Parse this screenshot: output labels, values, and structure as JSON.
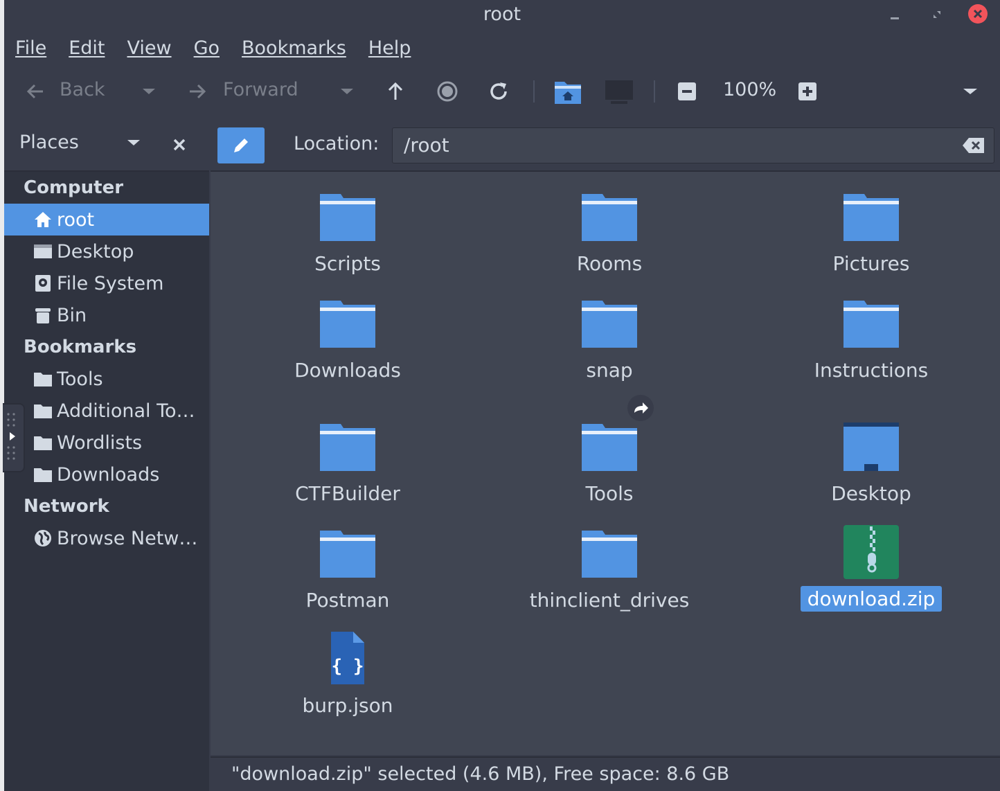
{
  "window": {
    "title": "root"
  },
  "menu": [
    {
      "label": "File"
    },
    {
      "label": "Edit"
    },
    {
      "label": "View"
    },
    {
      "label": "Go"
    },
    {
      "label": "Bookmarks"
    },
    {
      "label": "Help"
    }
  ],
  "toolbar": {
    "back_label": "Back",
    "forward_label": "Forward",
    "zoom_level": "100%"
  },
  "sidebar": {
    "places_label": "Places",
    "sections": {
      "computer": "Computer",
      "bookmarks": "Bookmarks",
      "network": "Network"
    },
    "computer_items": [
      {
        "label": "root",
        "icon": "home-icon"
      },
      {
        "label": "Desktop",
        "icon": "desktop-icon"
      },
      {
        "label": "File System",
        "icon": "drive-icon"
      },
      {
        "label": "Bin",
        "icon": "trash-icon"
      }
    ],
    "bookmark_items": [
      {
        "label": "Tools",
        "icon": "folder-icon"
      },
      {
        "label": "Additional To…",
        "icon": "folder-icon"
      },
      {
        "label": "Wordlists",
        "icon": "folder-icon"
      },
      {
        "label": "Downloads",
        "icon": "folder-icon"
      }
    ],
    "network_items": [
      {
        "label": "Browse Netw…",
        "icon": "network-icon"
      }
    ]
  },
  "location": {
    "label": "Location:",
    "value": "/root"
  },
  "files": [
    {
      "name": "Scripts",
      "type": "folder"
    },
    {
      "name": "Rooms",
      "type": "folder"
    },
    {
      "name": "Pictures",
      "type": "folder"
    },
    {
      "name": "Downloads",
      "type": "folder"
    },
    {
      "name": "snap",
      "type": "folder"
    },
    {
      "name": "Instructions",
      "type": "folder"
    },
    {
      "name": "CTFBuilder",
      "type": "folder"
    },
    {
      "name": "Tools",
      "type": "folder-link"
    },
    {
      "name": "Desktop",
      "type": "desktop-folder"
    },
    {
      "name": "Postman",
      "type": "folder"
    },
    {
      "name": "thinclient_drives",
      "type": "folder"
    },
    {
      "name": "download.zip",
      "type": "zip",
      "selected": true
    },
    {
      "name": "burp.json",
      "type": "json"
    }
  ],
  "status": {
    "text": "\"download.zip\" selected (4.6 MB), Free space: 8.6 GB"
  },
  "colors": {
    "accent": "#5294e2",
    "background": "#383c4a",
    "content": "#404552",
    "sidebar": "#2f333f",
    "close": "#f2545b"
  }
}
